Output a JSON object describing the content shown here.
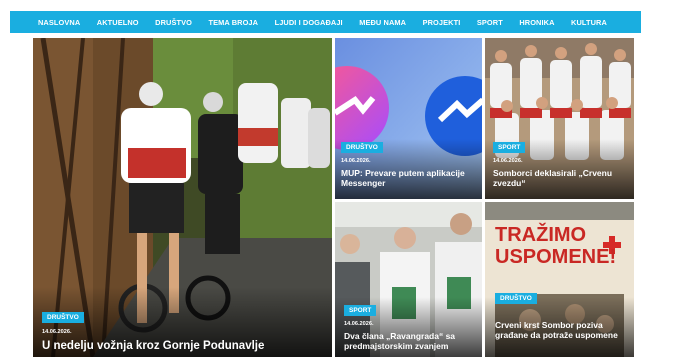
{
  "nav": [
    "NASLOVNA",
    "AKTUELNO",
    "DRUŠTVO",
    "TEMA BROJA",
    "LJUDI I DOGAĐAJI",
    "MEĐU NAMA",
    "PROJEKTI",
    "SPORT",
    "HRONIKA",
    "KULTURA"
  ],
  "articles": [
    {
      "category": "DRUŠTVO",
      "date": "14.06.2026.",
      "title": "U nedelju vožnja kroz Gornje Podunavlje"
    },
    {
      "category": "DRUŠTVO",
      "date": "14.06.2026.",
      "title": "MUP: Prevare putem aplikacije Messenger"
    },
    {
      "category": "SPORT",
      "date": "14.06.2026.",
      "title": "Somborci deklasirali „Crvenu zvezdu“"
    },
    {
      "category": "SPORT",
      "date": "14.06.2026.",
      "title": "Dva člana „Ravangrada“ sa predmajstorskim zvanjem"
    },
    {
      "category": "DRUŠTVO",
      "date": "",
      "title": "Crveni krst Sombor poziva građane da potraže uspomene"
    }
  ],
  "poster": {
    "line1": "TRAŽIMO",
    "line2": "USPOMENE!"
  },
  "colors": {
    "nav": "#1aaee0",
    "badge": "#1aaee0"
  }
}
